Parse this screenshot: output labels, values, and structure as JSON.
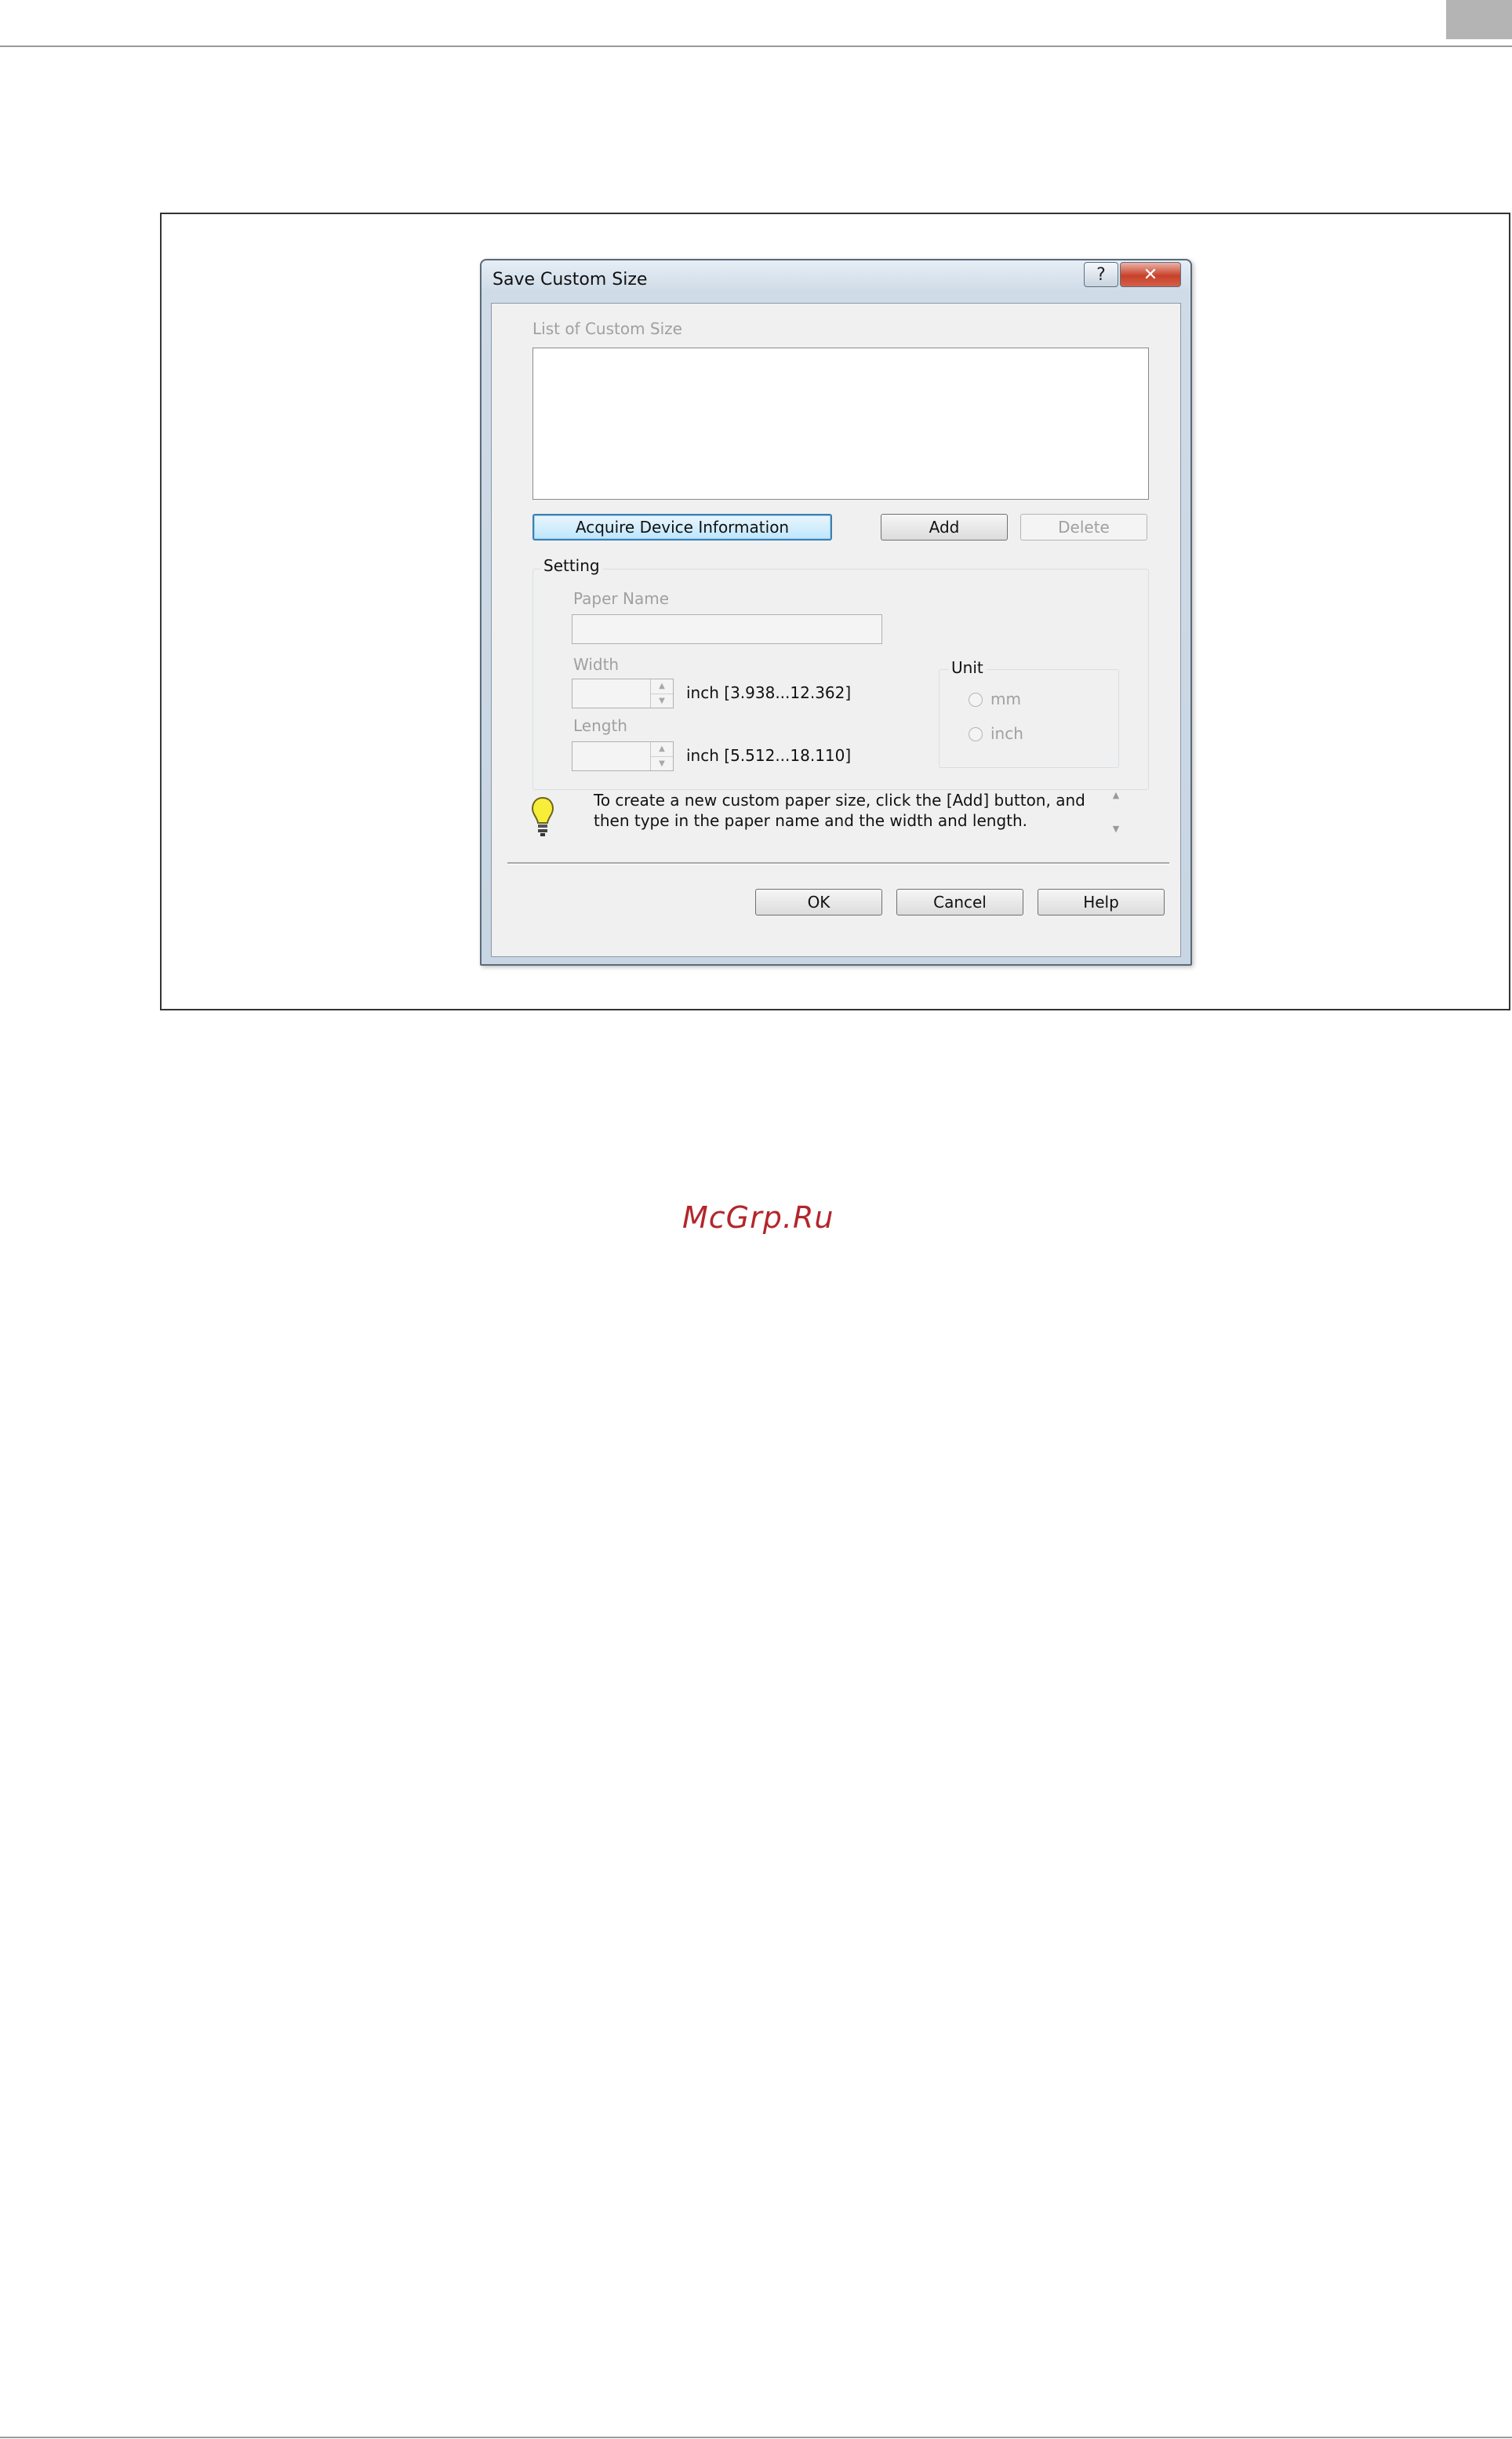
{
  "dialog": {
    "title": "Save Custom Size",
    "help_glyph": "?",
    "close_glyph": "✕",
    "list_label": "List of Custom Size",
    "buttons": {
      "acquire": "Acquire Device Information",
      "add": "Add",
      "delete": "Delete",
      "ok": "OK",
      "cancel": "Cancel",
      "help": "Help"
    },
    "setting": {
      "caption": "Setting",
      "paper_name_label": "Paper Name",
      "paper_name_value": "",
      "width_label": "Width",
      "width_value": "",
      "width_range": "inch [3.938...12.362]",
      "length_label": "Length",
      "length_value": "",
      "length_range": "inch [5.512...18.110]"
    },
    "unit": {
      "caption": "Unit",
      "options": [
        "mm",
        "inch"
      ]
    },
    "hint": "To create a new custom paper size, click the [Add] button, and then type in the paper name and the width and length."
  },
  "watermark": "McGrp.Ru",
  "colors": {
    "watermark": "#b3262c",
    "focus_border": "#3c7fb1",
    "close_button": "#c8412a"
  }
}
